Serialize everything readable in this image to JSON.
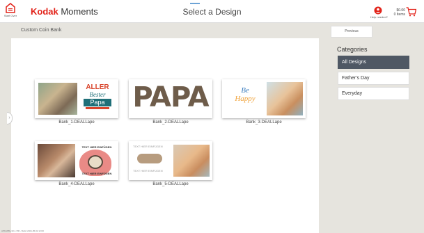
{
  "header": {
    "home_label": "Start Over",
    "brand_kodak": "Kodak",
    "brand_moments": " Moments",
    "title": "Select a Design",
    "help_label": "Help needed?",
    "cart_price": "$0.00",
    "cart_items": "0 Items"
  },
  "subtitle": "Custom Coin Bank",
  "previous_label": "Previous",
  "designs": [
    {
      "label": "Bank_1-DEALLape",
      "text_lines": [
        "ALLER",
        "Bester",
        "Papa"
      ]
    },
    {
      "label": "Bank_2-DEALLape",
      "text_lines": [
        "PAPA"
      ]
    },
    {
      "label": "Bank_3-DEALLape",
      "text_lines": [
        "Be",
        "Happy"
      ]
    },
    {
      "label": "Bank_4-DEALLape",
      "text_lines": [
        "TEXT HIER EINFÜGEN",
        "TEXT HIER EINFÜGEN"
      ]
    },
    {
      "label": "Bank_5-DEALLape",
      "text_lines": [
        "TEXT HIER EINFÜGEN",
        "TEXT HIER EINFÜGEN"
      ]
    }
  ],
  "categories": {
    "title": "Categories",
    "items": [
      "All Designs",
      "Father's Day",
      "Everyday"
    ],
    "active": "All Designs"
  },
  "version_text": "APKAPB-v10.1.796 - Build: 2021-05-02 12:00",
  "colors": {
    "brand_red": "#e2231a",
    "active_category": "#4f5864",
    "background": "#e6e4de"
  },
  "icons": [
    "home-icon",
    "help-icon",
    "cart-icon",
    "chevron-right-icon"
  ]
}
